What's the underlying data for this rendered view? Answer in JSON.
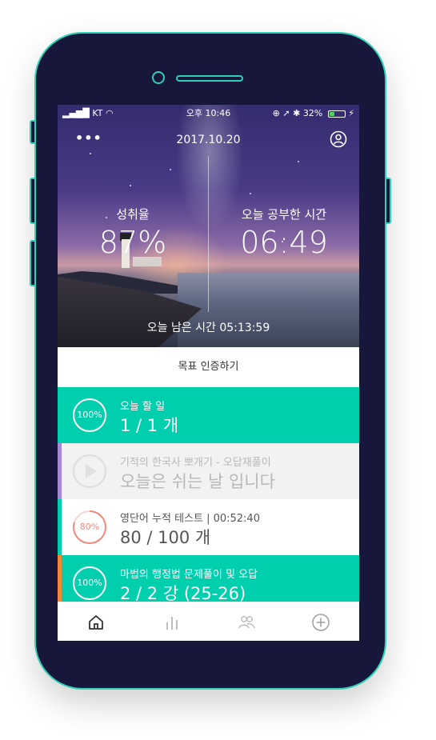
{
  "status_bar": {
    "signal": "KT",
    "time": "오후 10:46",
    "battery_percent": "32%",
    "battery_level": 0.32
  },
  "header": {
    "date": "2017.10.20",
    "menu_icon": "more-dots-icon",
    "profile_icon": "user-circle-icon"
  },
  "stats": {
    "achievement_label": "성취율",
    "achievement_value": "87%",
    "study_time_label": "오늘 공부한 시간",
    "study_time_value": "06:49",
    "remaining": "오늘 남은 시간 05:13:59"
  },
  "verify_button": "목표 인증하기",
  "cards": [
    {
      "percent": "100%",
      "progress": 1.0,
      "subtitle": "오늘 할 일",
      "main": "1 / 1 개",
      "bg": "#00cfae",
      "accent": "#00cfae",
      "text_color": "#ffffff",
      "ring_color": "#ffffff",
      "state": "done"
    },
    {
      "percent": "",
      "progress": 0,
      "subtitle": "기적의 한국사 뽀개기 - 오답재풀이",
      "main": "오늘은 쉬는 날 입니다",
      "bg": "#f2f2f2",
      "accent": "#a589d8",
      "text_color": "#b8b8b8",
      "ring_color": "#dddddd",
      "state": "rest"
    },
    {
      "percent": "80%",
      "progress": 0.8,
      "subtitle": "영단어 누적 테스트 | 00:52:40",
      "main": "80 / 100 개",
      "bg": "#ffffff",
      "accent": "#00cfae",
      "text_color": "#555555",
      "ring_color": "#f08a7e",
      "state": "active"
    },
    {
      "percent": "100%",
      "progress": 1.0,
      "subtitle": "마법의 행정법 문제풀이 및 오답",
      "main": "2 / 2 강 (25-26)",
      "bg": "#00cfae",
      "accent": "#f08a3a",
      "text_color": "#ffffff",
      "ring_color": "#ffffff",
      "state": "done"
    }
  ],
  "tabs": [
    {
      "name": "home-icon"
    },
    {
      "name": "stats-icon"
    },
    {
      "name": "group-icon"
    },
    {
      "name": "add-icon"
    }
  ]
}
